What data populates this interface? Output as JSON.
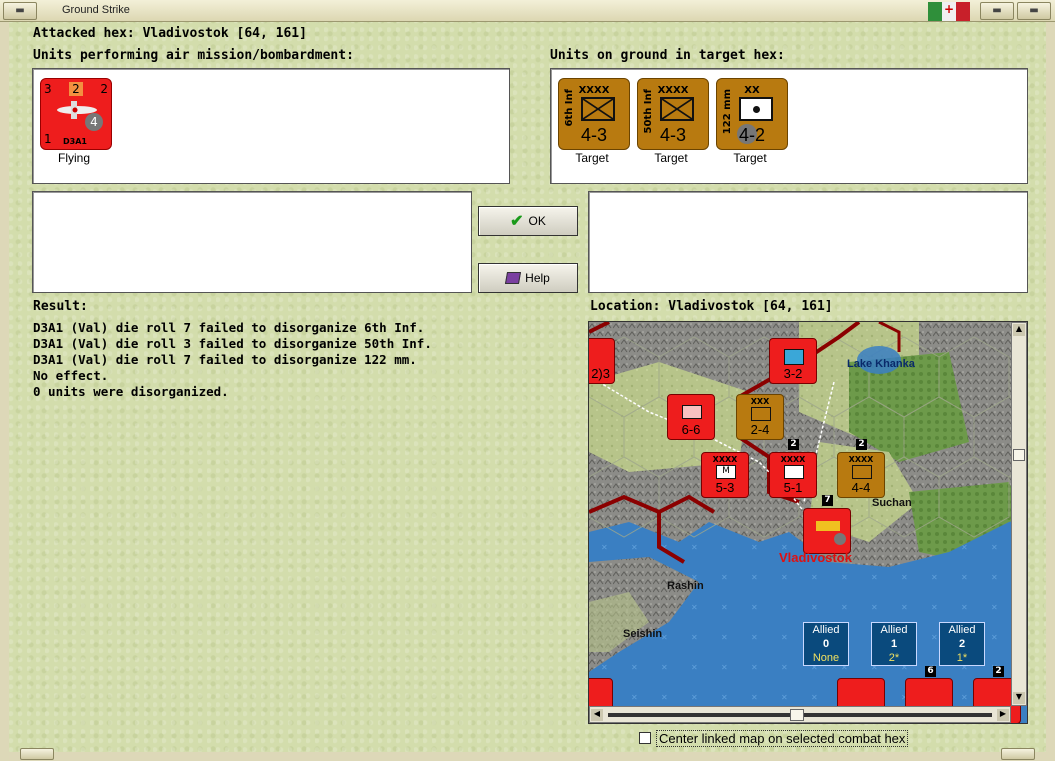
{
  "window": {
    "title": "Ground Strike"
  },
  "header": {
    "attacked_hex": "Attacked hex: Vladivostok  [64, 161]"
  },
  "air_units": {
    "label": "Units performing air mission/bombardment:",
    "units": [
      {
        "name": "D3A1",
        "top_left": "3",
        "top_mid": "2",
        "top_right": "2",
        "bottom_left": "1",
        "circle": "4",
        "status": "Flying"
      }
    ]
  },
  "ground_units": {
    "label": "Units on ground in target hex:",
    "units": [
      {
        "name": "6th Inf",
        "size": "XXXX",
        "strength": "4-3",
        "status": "Target"
      },
      {
        "name": "50th Inf",
        "size": "XXXX",
        "strength": "4-3",
        "status": "Target"
      },
      {
        "name": "122 mm",
        "size": "XX",
        "strength": "4-2",
        "status": "Target"
      }
    ]
  },
  "buttons": {
    "ok": "OK",
    "help": "Help"
  },
  "result": {
    "label": "Result:",
    "lines": [
      "D3A1 (Val) die roll 7 failed to disorganize 6th Inf.",
      "D3A1 (Val) die roll 3 failed to disorganize 50th Inf.",
      "D3A1 (Val) die roll 7 failed to disorganize 122 mm.",
      "No effect.",
      "0 units were disorganized."
    ]
  },
  "location": {
    "label": "Location:  Vladivostok  [64, 161]",
    "map_labels": {
      "lake": "Lake Khanka",
      "suchan": "Suchan",
      "vladivostok": "Vladivostok",
      "rashin": "Rashin",
      "seishin": "Seishin"
    },
    "map_counters": [
      {
        "strength": "3-2"
      },
      {
        "strength": "6-6"
      },
      {
        "strength": "2-4"
      },
      {
        "strength": "5-3"
      },
      {
        "strength": "5-1"
      },
      {
        "strength": "4-4"
      },
      {
        "strength": "2)3"
      }
    ],
    "allied_boxes": [
      {
        "title": "Allied",
        "value": "0",
        "sub": "None"
      },
      {
        "title": "Allied",
        "value": "1",
        "sub": "2*"
      },
      {
        "title": "Allied",
        "value": "2",
        "sub": "1*"
      }
    ]
  },
  "checkbox": {
    "label": "Center linked map on selected combat hex",
    "checked": false
  },
  "colors": {
    "axis_red": "#ee1d1d",
    "soviet_brown": "#b87a10",
    "sea": "#3a7fc2",
    "border_red": "#8b0000"
  }
}
